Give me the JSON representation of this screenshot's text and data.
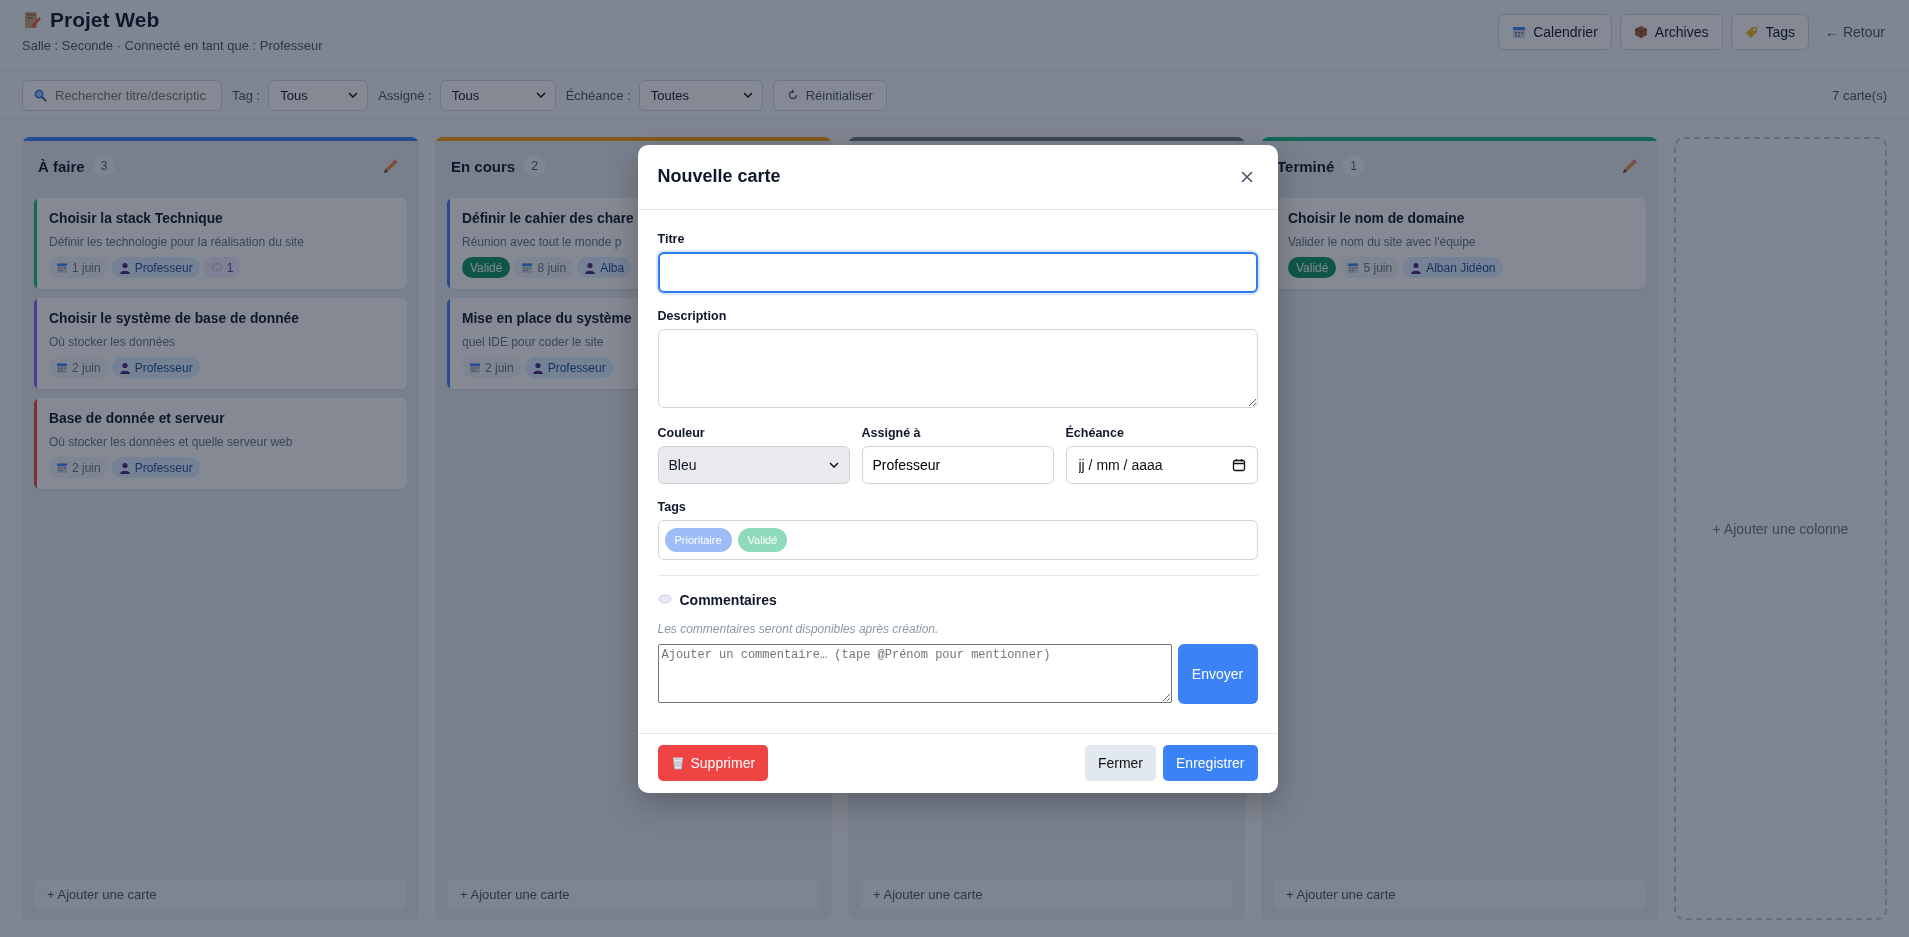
{
  "header": {
    "title": "Projet Web",
    "subtitle": "Salle : Seconde · Connecté en tant que : Professeur",
    "buttons": [
      "Calendrier",
      "Archives",
      "Tags"
    ],
    "back_link": "← Retour"
  },
  "toolbar": {
    "search": {
      "placeholder": "Rechercher titre/descriptic"
    },
    "filters": [
      {
        "label": "Tag :",
        "value": "Tous"
      },
      {
        "label": "Assigné :",
        "value": "Tous"
      },
      {
        "label": "Échéance :",
        "value": "Toutes"
      }
    ],
    "reset_button": "Réinitialiser",
    "card_count": "7 carte(s)"
  },
  "columns": [
    {
      "title": "À faire",
      "count": "3",
      "color": "#254c90",
      "edit_icon": true,
      "cards": [
        {
          "title": "Choisir la stack Technique",
          "description": "Définir les technologie pour la réalisation du site",
          "color": "#106855",
          "meta": [
            {
              "kind": "date",
              "text": "1 juin"
            },
            {
              "kind": "assignee",
              "text": "Professeur"
            },
            {
              "kind": "comments",
              "text": "1"
            }
          ]
        },
        {
          "title": "Choisir le système de base de donnée",
          "description": "Où stocker les données",
          "color": "#4d3a90",
          "meta": [
            {
              "kind": "date",
              "text": "2 juin"
            },
            {
              "kind": "assignee",
              "text": "Professeur"
            }
          ]
        },
        {
          "title": "Base de donnée et serveur",
          "description": "Où stocker les données et quelle serveur web",
          "color": "#7f2e37",
          "meta": [
            {
              "kind": "date",
              "text": "2 juin"
            },
            {
              "kind": "assignee",
              "text": "Professeur"
            }
          ]
        }
      ],
      "add_card": "+ Ajouter une carte"
    },
    {
      "title": "En cours",
      "count": "2",
      "color": "#825a1b",
      "cards": [
        {
          "title": "Définir le cahier des chare",
          "description": "Réunion avec tout le monde p",
          "color": "#254c90",
          "meta": [
            {
              "kind": "tag",
              "text": "Validé"
            },
            {
              "kind": "date",
              "text": "8 juin"
            },
            {
              "kind": "assignee",
              "text": "Alba"
            }
          ]
        },
        {
          "title": "Mise en place du système",
          "description": "quel IDE pour coder le site",
          "color": "#254c90",
          "meta": [
            {
              "kind": "date",
              "text": "2 juin"
            },
            {
              "kind": "assignee",
              "text": "Professeur"
            }
          ]
        }
      ],
      "add_card": "+ Ajouter une carte"
    },
    {
      "color": "#3d4455",
      "add_card": "+ Ajouter une carte"
    },
    {
      "title": "Terminé",
      "count": "1",
      "color": "#106855",
      "edit_icon": true,
      "cards": [
        {
          "title": "Choisir le nom de domaine",
          "description": "Valider le nom du site avec l'équipe",
          "meta": [
            {
              "kind": "tag",
              "text": "Validé"
            },
            {
              "kind": "date",
              "text": "5 juin"
            },
            {
              "kind": "assignee",
              "text": "Alban Jidéon"
            }
          ]
        }
      ],
      "add_card": "+ Ajouter une carte"
    }
  ],
  "add_column": "+ Ajouter une colonne",
  "modal": {
    "title": "Nouvelle carte",
    "fields": {
      "title": {
        "label": "Titre",
        "focused": true
      },
      "description": {
        "label": "Description"
      },
      "color": {
        "label": "Couleur",
        "value": "Bleu"
      },
      "assignee": {
        "label": "Assigné à",
        "value": "Professeur"
      },
      "due": {
        "label": "Échéance",
        "placeholder": "jj / mm / aaaa"
      }
    },
    "tags": {
      "label": "Tags",
      "items": [
        {
          "label": "Prioritaire",
          "color": "#9dbcf9",
          "selected": false
        },
        {
          "label": "Validé",
          "color": "#8edbbb",
          "selected": false
        }
      ]
    },
    "comments": {
      "title": "Commentaires",
      "note": "Les commentaires seront disponibles après création.",
      "placeholder": "Ajouter un commentaire… (tape @Prénom pour mentionner)",
      "send_button": "Envoyer"
    },
    "delete_button": "Supprimer",
    "close_button": "Fermer",
    "save_button": "Enregistrer"
  }
}
